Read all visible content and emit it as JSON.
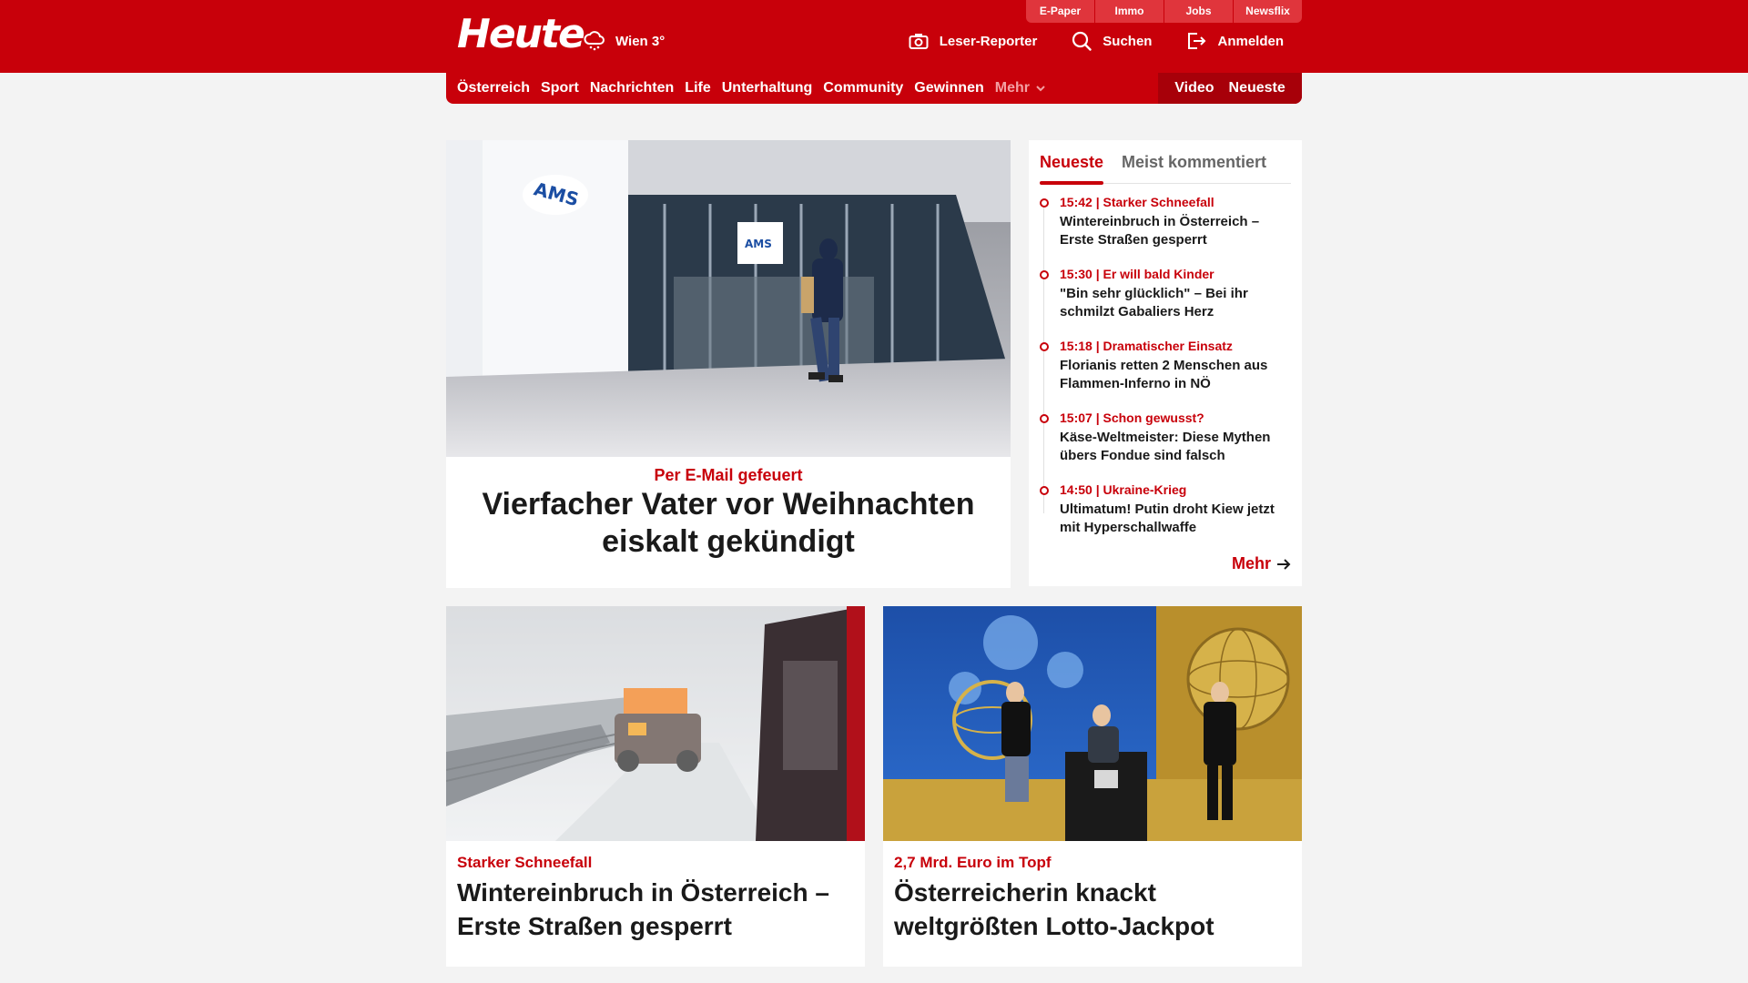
{
  "header": {
    "logo": "Heute",
    "weather": {
      "icon": "snow-cloud-icon",
      "text": "Wien 3°"
    },
    "top_links": [
      "E-Paper",
      "Immo",
      "Jobs",
      "Newsflix"
    ],
    "actions": [
      {
        "icon": "camera-icon",
        "label": "Leser-Reporter"
      },
      {
        "icon": "search-icon",
        "label": "Suchen"
      },
      {
        "icon": "login-icon",
        "label": "Anmelden"
      }
    ]
  },
  "nav": {
    "items": [
      "Österreich",
      "Sport",
      "Nachrichten",
      "Life",
      "Unterhaltung",
      "Community",
      "Gewinnen"
    ],
    "more": "Mehr",
    "right": [
      "Video",
      "Neueste"
    ]
  },
  "hero": {
    "kicker": "Per E-Mail gefeuert",
    "title": "Vierfacher Vater vor Weihnachten eiskalt gekündigt"
  },
  "sidebar": {
    "tabs": [
      "Neueste",
      "Meist kommentiert"
    ],
    "items": [
      {
        "meta": "15:42 | Starker Schneefall",
        "title": "Wintereinbruch in Österreich – Erste Straßen gesperrt"
      },
      {
        "meta": "15:30 | Er will bald Kinder",
        "title": "\"Bin sehr glücklich\" – Bei ihr schmilzt Gabaliers Herz"
      },
      {
        "meta": "15:18 | Dramatischer Einsatz",
        "title": "Florianis retten 2 Menschen aus Flammen-Inferno in NÖ"
      },
      {
        "meta": "15:07 | Schon gewusst?",
        "title": "Käse-Weltmeister: Diese Mythen übers Fondue sind falsch"
      },
      {
        "meta": "14:50 | Ukraine-Krieg",
        "title": "Ultimatum! Putin droht Kiew jetzt mit Hyperschallwaffe"
      }
    ],
    "more_label": "Mehr"
  },
  "cards": [
    {
      "kicker": "Starker Schneefall",
      "title": "Wintereinbruch in Österreich – Erste Straßen gesperrt"
    },
    {
      "kicker": "2,7 Mrd. Euro im Topf",
      "title": "Österreicherin knackt weltgrößten Lotto-Jackpot"
    }
  ],
  "colors": {
    "brand_red": "#c8000a",
    "dark_red": "#a70009"
  }
}
